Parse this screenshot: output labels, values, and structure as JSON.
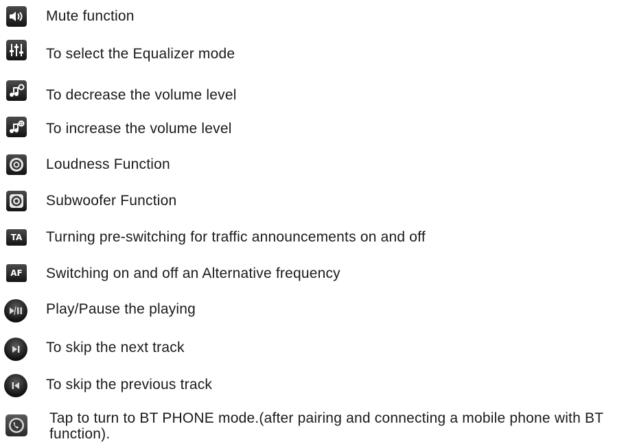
{
  "items": [
    {
      "icon": "speaker-icon",
      "label": "Mute function"
    },
    {
      "icon": "equalizer-sliders-icon",
      "label": "To select the Equalizer mode"
    },
    {
      "icon": "volume-down-note-icon",
      "label": "To decrease the volume level"
    },
    {
      "icon": "volume-up-note-icon",
      "label": "To increase the volume level"
    },
    {
      "icon": "loudness-target-icon",
      "label": "Loudness Function"
    },
    {
      "icon": "subwoofer-icon",
      "label": "Subwoofer Function"
    },
    {
      "icon": "ta-badge-icon",
      "badge": "TA",
      "label": "Turning pre-switching for traffic announcements on and off"
    },
    {
      "icon": "af-badge-icon",
      "badge": "AF",
      "label": "Switching on and off an Alternative frequency"
    },
    {
      "icon": "play-pause-icon",
      "label": "Play/Pause the playing"
    },
    {
      "icon": "next-track-icon",
      "label": "To skip the next track"
    },
    {
      "icon": "previous-track-icon",
      "label": "To skip the previous track"
    },
    {
      "icon": "phone-icon",
      "label": "Tap to turn to BT PHONE mode.(after pairing and connecting a mobile phone with BT function)."
    }
  ]
}
